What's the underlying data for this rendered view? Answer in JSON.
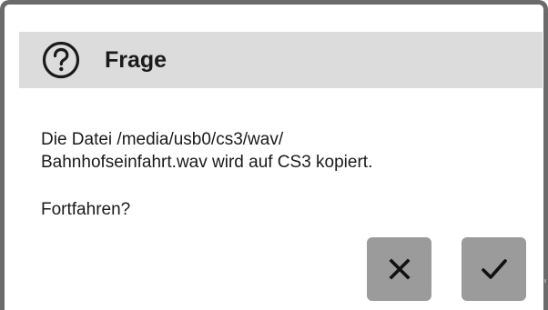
{
  "dialog": {
    "title": "Frage",
    "icon": "question-circle-icon",
    "message_lines": [
      "Die Datei /media/usb0/cs3/wav/",
      "Bahnhofseinfahrt.wav wird auf CS3 kopiert."
    ],
    "question": "Fortfahren?",
    "buttons": {
      "cancel_icon": "close-icon",
      "confirm_icon": "checkmark-icon"
    },
    "colors": {
      "border": "#6b6b6b",
      "header_bg": "#dcdcdc",
      "button_bg": "#9b9b9b",
      "text": "#1a1a1a"
    }
  }
}
